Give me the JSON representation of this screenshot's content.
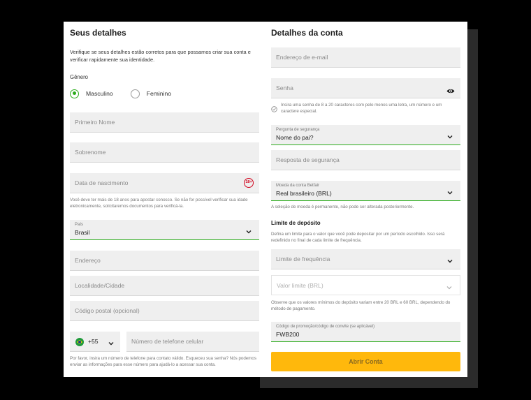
{
  "left": {
    "title": "Seus detalhes",
    "intro": "Verifique se seus detalhes estão corretos para que possamos criar sua conta e verificar rapidamente sua identidade.",
    "gender_label": "Gênero",
    "gender_options": [
      "Masculino",
      "Feminino"
    ],
    "gender_selected": "Masculino",
    "first_name_placeholder": "Primeiro Nome",
    "last_name_placeholder": "Sobrenome",
    "dob_placeholder": "Data de nascimento",
    "age_badge": "18+",
    "dob_hint": "Você deve ter mais de 18 anos para apostar conosco. Se não for possível verificar sua idade eletronicamente, solicitaremos documentos para verificá-la.",
    "country_label": "País",
    "country_value": "Brasil",
    "address_placeholder": "Endereço",
    "city_placeholder": "Localidade/Cidade",
    "postal_placeholder": "Código postal (opcional)",
    "phone_code": "+55",
    "phone_placeholder": "Número de telefone celular",
    "phone_hint": "Por favor, insira um número de telefone para contato válido. Esqueceu sua senha? Nós podemos enviar as informações para esse número para ajudá-lo a acessar sua conta."
  },
  "right": {
    "title": "Detalhes da conta",
    "email_placeholder": "Endereço de e-mail",
    "password_placeholder": "Senha",
    "password_hint": "Insira uma senha de 8 a 20 caracteres com pelo menos uma letra, um número e um caractere especial.",
    "security_question_label": "Pergunta de segurança",
    "security_question_value": "Nome do pai?",
    "security_answer_placeholder": "Resposta de segurança",
    "currency_label": "Moeda da conta Betfair",
    "currency_value": "Real brasileiro (BRL)",
    "currency_hint": "A seleção de moeda é permanente, não pode ser alterada posteriormente.",
    "deposit_title": "Limite de depósito",
    "deposit_intro": "Defina um limite para o valor que você pode depositar por um período escolhido. Isso será redefinido no final de cada limite de frequência.",
    "frequency_placeholder": "Limite de frequência",
    "limit_value_placeholder": "Valor limite (BRL)",
    "deposit_hint": "Observe que os valores mínimos do depósito variam entre 20 BRL e 60 BRL, dependendo do método de pagamento.",
    "promo_label": "Código de promoção/código de convite (se aplicável)",
    "promo_value": "FWB200",
    "submit_label": "Abrir Conta"
  },
  "colors": {
    "accent_green": "#2cac1c",
    "button_yellow": "#ffb80c",
    "age_badge_red": "#d0021b"
  },
  "icons": [
    "chevron-down-icon",
    "eye-icon",
    "check-circle-icon",
    "brazil-flag-icon",
    "age-18-badge"
  ]
}
